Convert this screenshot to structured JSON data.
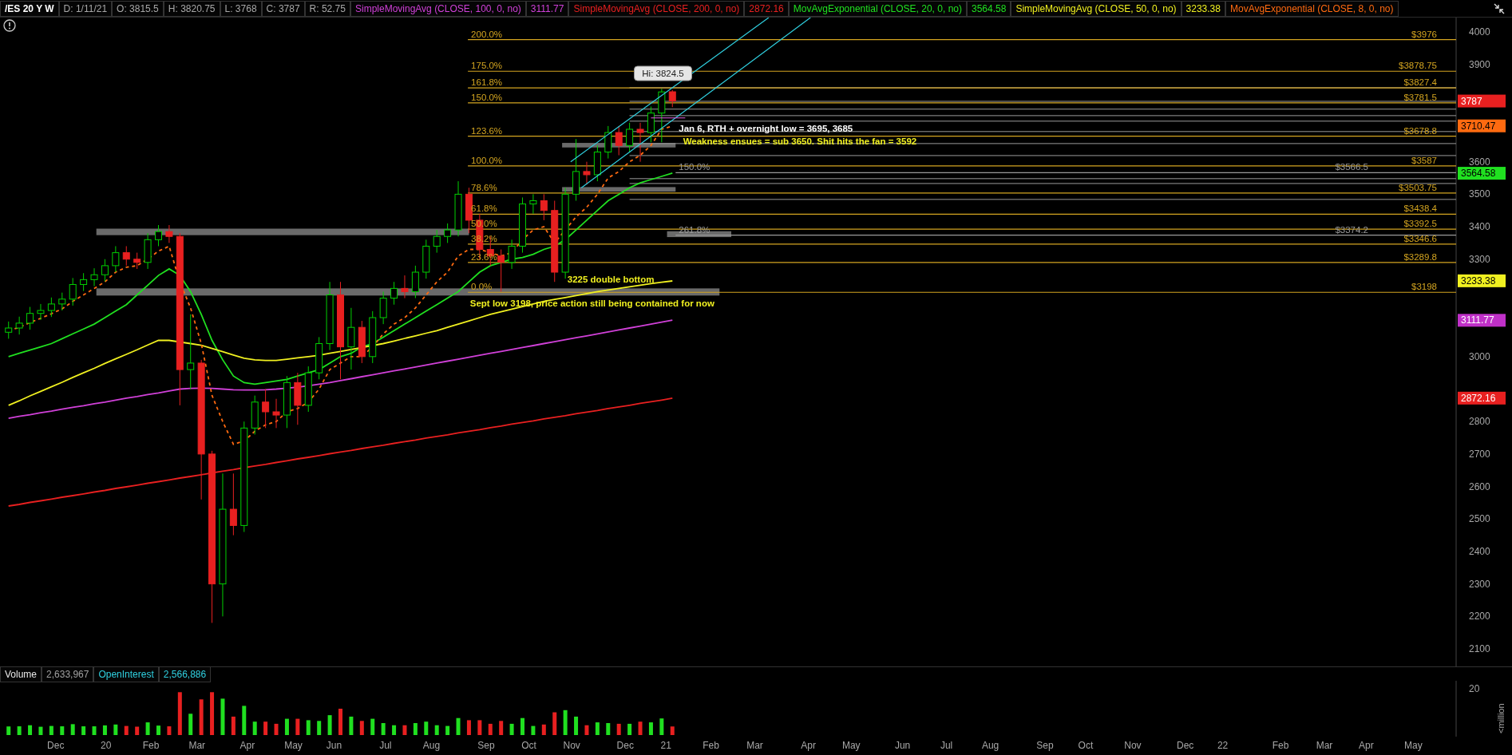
{
  "header": {
    "symbol": "/ES 20 Y W",
    "quote": [
      "D: 1/11/21",
      "O: 3815.5",
      "H: 3820.75",
      "L: 3768",
      "C: 3787",
      "R: 52.75"
    ],
    "studies": [
      {
        "label": "SimpleMovingAvg (CLOSE, 100, 0, no)",
        "value": "3111.77",
        "color": "#d040d8"
      },
      {
        "label": "SimpleMovingAvg (CLOSE, 200, 0, no)",
        "value": "2872.16",
        "color": "#e82020"
      },
      {
        "label": "MovAvgExponential (CLOSE, 20, 0, no)",
        "value": "3564.58",
        "color": "#20e020"
      },
      {
        "label": "SimpleMovingAvg (CLOSE, 50, 0, no)",
        "value": "3233.38",
        "color": "#f0f020"
      },
      {
        "label": "MovAvgExponential (CLOSE, 8, 0, no)",
        "color": "#ff6a10"
      }
    ]
  },
  "chart": {
    "fib_levels": [
      {
        "label": "200.0%",
        "price_label": "$3976",
        "kind": "primary"
      },
      {
        "label": "175.0%",
        "price_label": "$3878.75",
        "kind": "primary"
      },
      {
        "label": "161.8%",
        "price_label": "$3827.4",
        "kind": "primary"
      },
      {
        "label": "150.0%",
        "price_label": "$3781.5",
        "kind": "primary"
      },
      {
        "label": "123.6%",
        "price_label": "$3678.8",
        "kind": "primary"
      },
      {
        "label": "100.0%",
        "price_label": "$3587",
        "kind": "primary"
      },
      {
        "label": "78.6%",
        "price_label": "$3503.75",
        "kind": "primary"
      },
      {
        "label": "61.8%",
        "price_label": "$3438.4",
        "kind": "primary"
      },
      {
        "label": "50.0%",
        "price_label": "$3392.5",
        "kind": "primary"
      },
      {
        "label": "38.2%",
        "price_label": "$3346.6",
        "kind": "primary"
      },
      {
        "label": "23.6%",
        "price_label": "$3289.8",
        "kind": "primary"
      },
      {
        "label": "0.0%",
        "price_label": "$3198",
        "kind": "primary"
      },
      {
        "label": "150.0%",
        "price_label": "$3566.5",
        "kind": "secondary"
      },
      {
        "label": "261.8%",
        "price_label": "$3374.2",
        "kind": "secondary"
      }
    ],
    "callout": "Hi: 3824.5",
    "notes": [
      {
        "text": "Jan 6, RTH + overnight low = 3695, 3685",
        "color": "#ffffff"
      },
      {
        "text": "Weakness ensues = sub 3650. Shit hits the fan = 3592",
        "color": "#f0f020"
      },
      {
        "text": "3225 double bottom",
        "color": "#f0f020"
      },
      {
        "text": "Sept low 3198, price action still being contained for now",
        "color": "#f0f020"
      }
    ],
    "price_axis": [
      "4000",
      "3900",
      "3600",
      "3500",
      "3400",
      "3300",
      "3000",
      "2800",
      "2700",
      "2600",
      "2500",
      "2400",
      "2300",
      "2200",
      "2100"
    ],
    "price_tags": [
      {
        "text": "3787",
        "color": "#e82020"
      },
      {
        "text": "3710.47",
        "color": "#ff6a10"
      },
      {
        "text": "3564.58",
        "color": "#20e020"
      },
      {
        "text": "3233.38",
        "color": "#f0f020"
      },
      {
        "text": "3111.77",
        "color": "#c030c8"
      },
      {
        "text": "2872.16",
        "color": "#e82020"
      }
    ],
    "time_axis": [
      "Dec",
      "20",
      "Feb",
      "Mar",
      "Apr",
      "May",
      "Jun",
      "Jul",
      "Aug",
      "Sep",
      "Oct",
      "Nov",
      "Dec",
      "21",
      "Feb",
      "Mar",
      "Apr",
      "May",
      "Jun",
      "Jul",
      "Aug",
      "Sep",
      "Oct",
      "Nov",
      "Dec",
      "22",
      "Feb",
      "Mar",
      "Apr",
      "May"
    ]
  },
  "volume": {
    "items": [
      {
        "text": "Volume",
        "color": "#e8e8e8"
      },
      {
        "text": "2,633,967",
        "color": "#a0a0a0"
      },
      {
        "text": "OpenInterest",
        "color": "#30d0e0"
      },
      {
        "text": "2,566,886",
        "color": "#30d0e0"
      }
    ],
    "axis_label": "20",
    "unit": "<million"
  }
}
